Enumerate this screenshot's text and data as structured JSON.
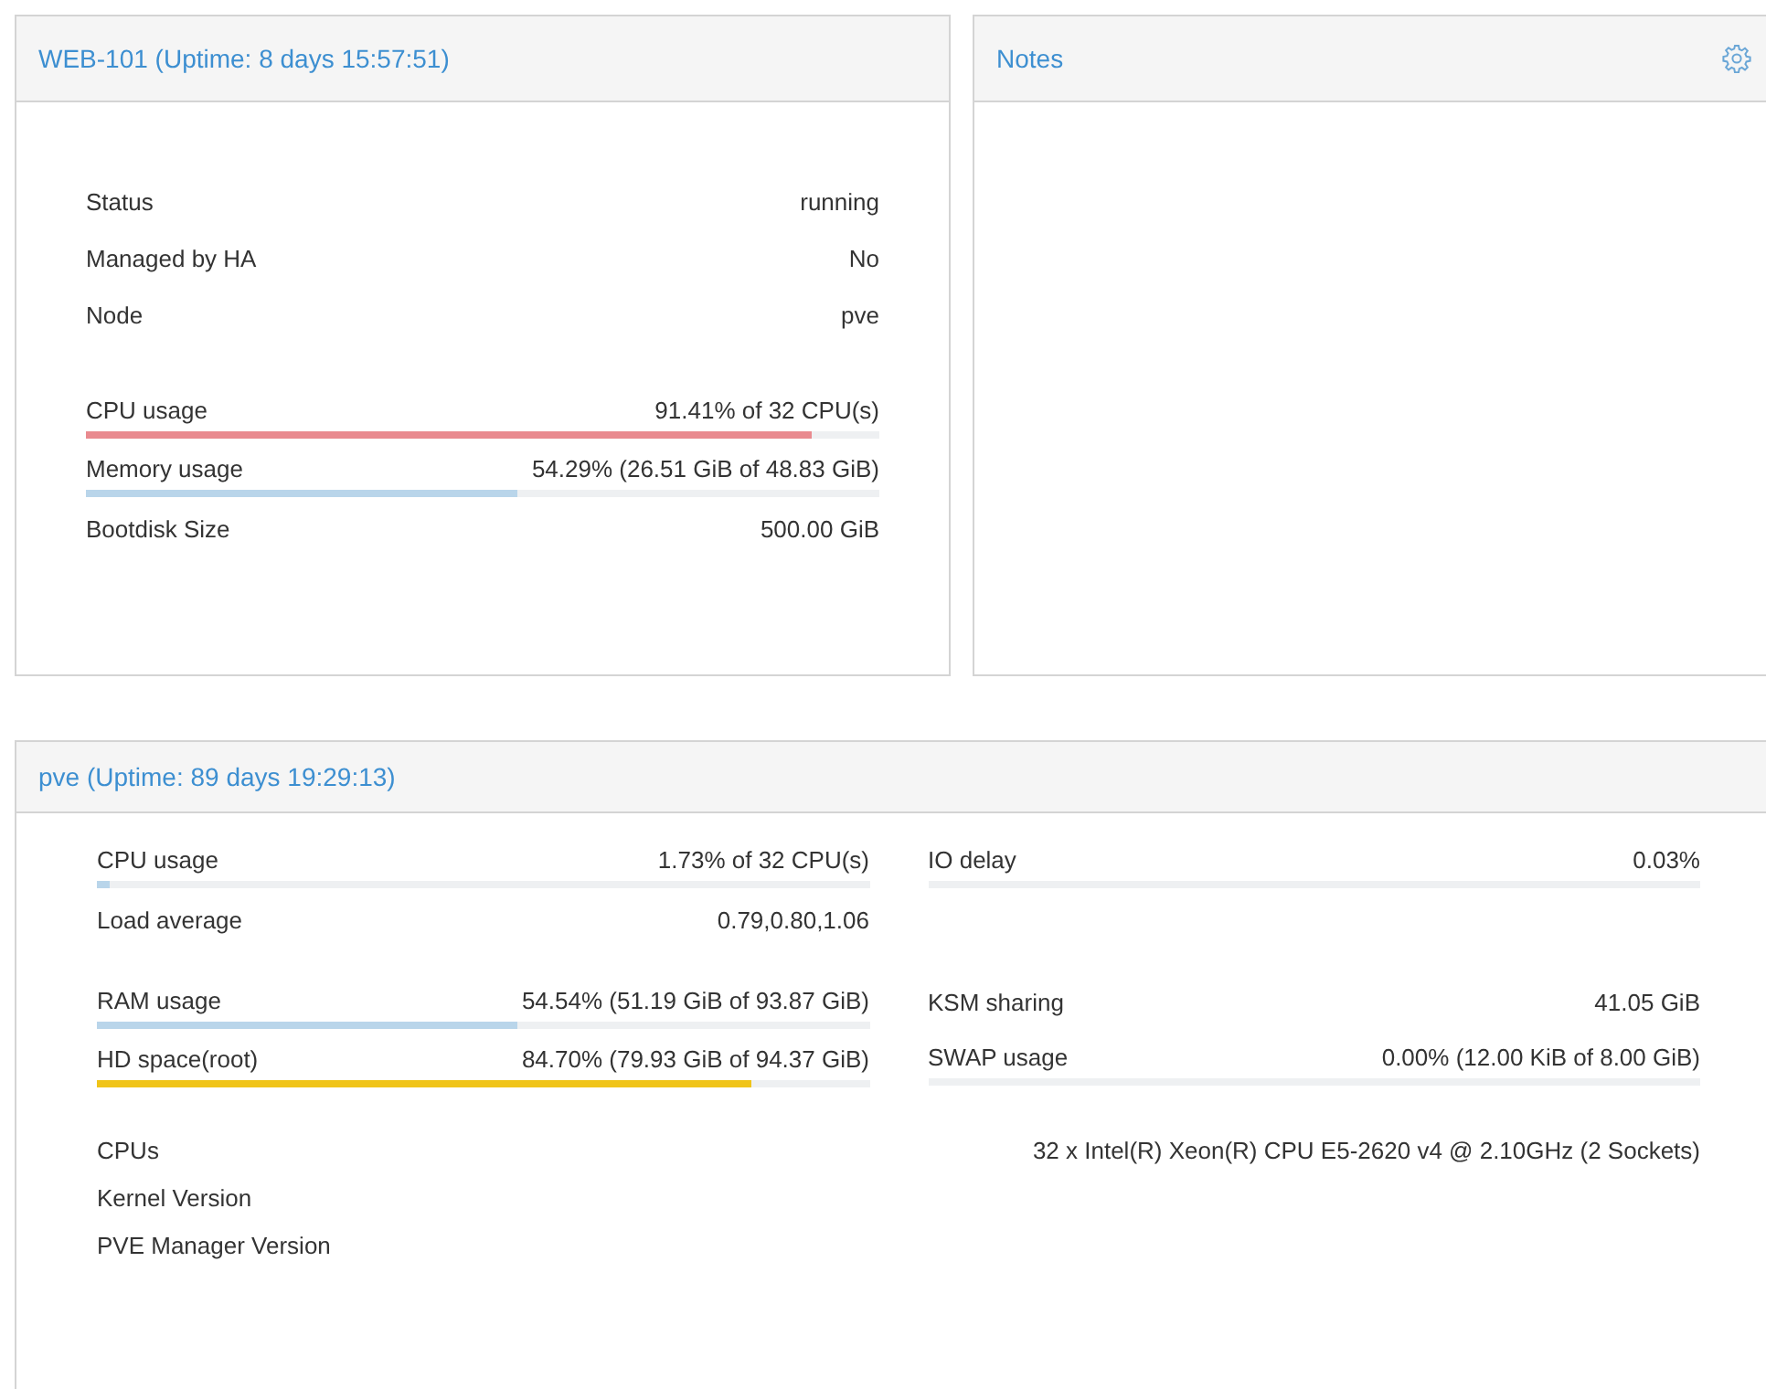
{
  "guest": {
    "title": "WEB-101 (Uptime: 8 days 15:57:51)",
    "groups": [
      [
        {
          "kind": "info",
          "label": "Status",
          "value": "running"
        },
        {
          "kind": "info",
          "label": "Managed by HA",
          "value": "No"
        },
        {
          "kind": "info",
          "label": "Node",
          "value": "pve"
        }
      ],
      [
        {
          "kind": "bar",
          "label": "CPU usage",
          "value": "91.41% of 32 CPU(s)",
          "level": 0.914,
          "color": "#e98a8f"
        },
        {
          "kind": "bar",
          "label": "Memory usage",
          "value": "54.29% (26.51 GiB of 48.83 GiB)",
          "level": 0.543,
          "color": "#b9d5ea"
        },
        {
          "kind": "info",
          "label": "Bootdisk Size",
          "value": "500.00 GiB"
        }
      ]
    ]
  },
  "notes": {
    "title": "Notes"
  },
  "node": {
    "title": "pve (Uptime: 89 days 19:29:13)",
    "sections": [
      {
        "left": [
          {
            "kind": "bar",
            "label": "CPU usage",
            "value": "1.73% of 32 CPU(s)",
            "level": 0.017,
            "color": "#b9d5ea"
          },
          {
            "kind": "info",
            "label": "Load average",
            "value": "0.79,0.80,1.06"
          }
        ],
        "right": [
          {
            "kind": "bar",
            "label": "IO delay",
            "value": "0.03%",
            "level": 0.0
          }
        ]
      },
      {
        "left": [
          {
            "kind": "bar",
            "label": "RAM usage",
            "value": "54.54% (51.19 GiB of 93.87 GiB)",
            "level": 0.545,
            "color": "#b9d5ea"
          },
          {
            "kind": "bar",
            "label": "HD space(root)",
            "value": "84.70% (79.93 GiB of 94.37 GiB)",
            "level": 0.847,
            "color": "#f0c419"
          }
        ],
        "right": [
          {
            "kind": "info",
            "label": "KSM sharing",
            "value": "41.05 GiB"
          },
          {
            "kind": "bar",
            "label": "SWAP usage",
            "value": "0.00% (12.00 KiB of 8.00 GiB)",
            "level": 0.0
          }
        ]
      }
    ],
    "info": [
      {
        "label": "CPUs",
        "value": "32 x Intel(R) Xeon(R) CPU E5-2620 v4 @ 2.10GHz (2 Sockets)"
      },
      {
        "label": "Kernel Version"
      },
      {
        "label": "PVE Manager Version"
      }
    ]
  }
}
